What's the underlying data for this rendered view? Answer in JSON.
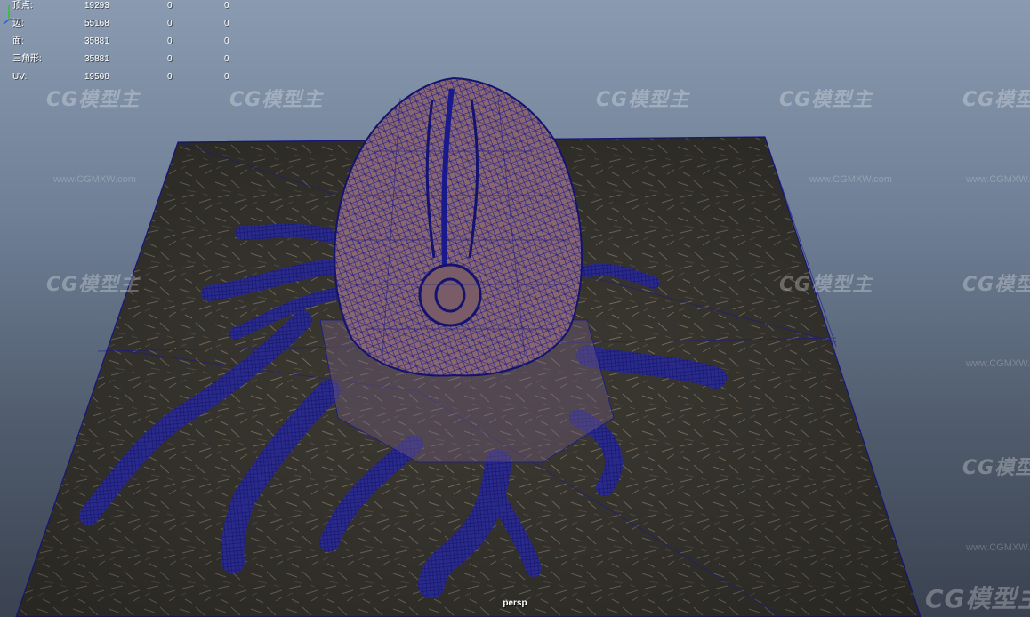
{
  "poly_count": {
    "rows": [
      {
        "label": "顶点:",
        "total": "19293",
        "selected": "0",
        "component": "0"
      },
      {
        "label": "边:",
        "total": "55168",
        "selected": "0",
        "component": "0"
      },
      {
        "label": "面:",
        "total": "35881",
        "selected": "0",
        "component": "0"
      },
      {
        "label": "三角形:",
        "total": "35881",
        "selected": "0",
        "component": "0"
      },
      {
        "label": "UV:",
        "total": "19508",
        "selected": "0",
        "component": "0"
      }
    ]
  },
  "watermark": {
    "logo": "CG模型主",
    "url": "www.CGMXW.com"
  },
  "viewport": {
    "camera": "persp",
    "background_top": "#8a9bb1",
    "background_bottom": "#3a4250",
    "ground_color": "#3e3b34",
    "wire_color": "#1a1a8c",
    "mesh_fill": "#8a6770"
  },
  "icons": [
    "axis-gizmo-icon"
  ]
}
